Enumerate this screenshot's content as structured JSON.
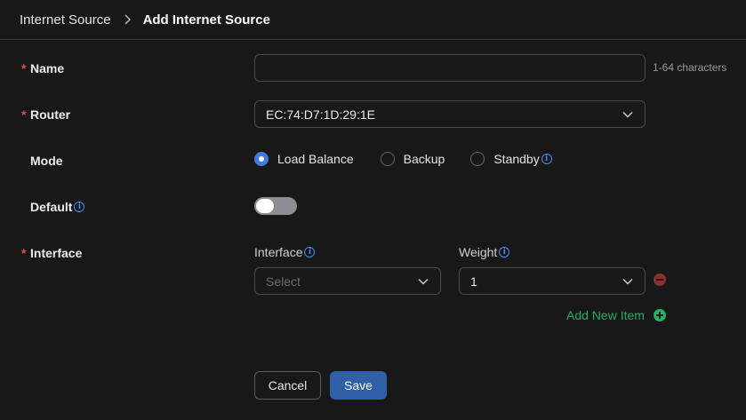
{
  "breadcrumb": {
    "parent": "Internet Source",
    "current": "Add Internet Source"
  },
  "form": {
    "name": {
      "label": "Name",
      "required": true,
      "value": "",
      "placeholder": "",
      "hint": "1-64 characters"
    },
    "router": {
      "label": "Router",
      "required": true,
      "value": "EC:74:D7:1D:29:1E"
    },
    "mode": {
      "label": "Mode",
      "options": [
        {
          "label": "Load Balance",
          "checked": true
        },
        {
          "label": "Backup",
          "checked": false
        },
        {
          "label": "Standby",
          "checked": false,
          "info": true
        }
      ]
    },
    "default": {
      "label": "Default",
      "enabled": false
    },
    "interface": {
      "label": "Interface",
      "required": true,
      "col_interface": "Interface",
      "col_weight": "Weight",
      "interface_placeholder": "Select",
      "weight_value": "1",
      "add_label": "Add New Item"
    }
  },
  "actions": {
    "cancel": "Cancel",
    "save": "Save"
  },
  "colors": {
    "accent": "#3d7be0",
    "save": "#2f5fa7",
    "required": "#e5484d",
    "add": "#25b063",
    "remove": "#8b2f2f"
  }
}
